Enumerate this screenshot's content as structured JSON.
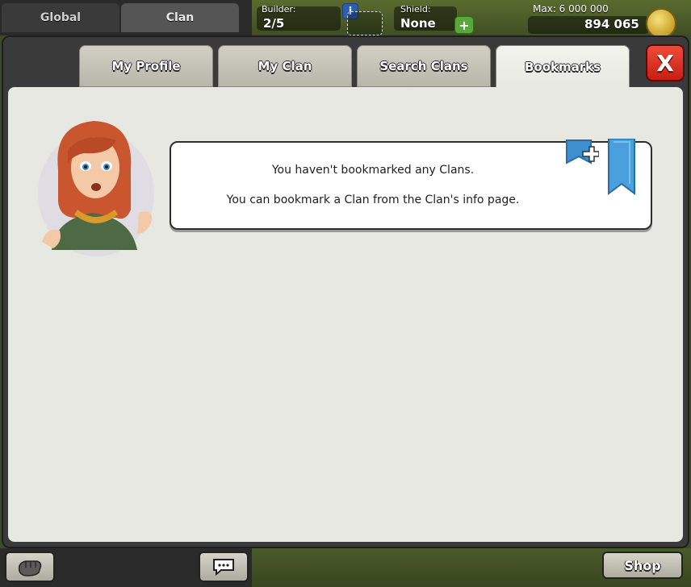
{
  "chat_tabs": {
    "global": "Global",
    "clan": "Clan"
  },
  "hud": {
    "builder_label": "Builder:",
    "builder_value": "2/5",
    "shield_label": "Shield:",
    "shield_value": "None",
    "gold_max_label": "Max: 6 000 000",
    "gold_value": "894 065"
  },
  "tabs": [
    {
      "label": "My Profile",
      "active": false
    },
    {
      "label": "My Clan",
      "active": false
    },
    {
      "label": "Search Clans",
      "active": false
    },
    {
      "label": "Bookmarks",
      "active": true
    }
  ],
  "close_label": "X",
  "message": {
    "line1": "You haven't bookmarked any Clans.",
    "line2": "You can bookmark a Clan from the Clan's info page."
  },
  "bottom": {
    "shop_label": "Shop"
  },
  "colors": {
    "panel_bg": "#e8e8e2",
    "close_red": "#e03628",
    "bookmark_blue": "#3d8fd0"
  }
}
